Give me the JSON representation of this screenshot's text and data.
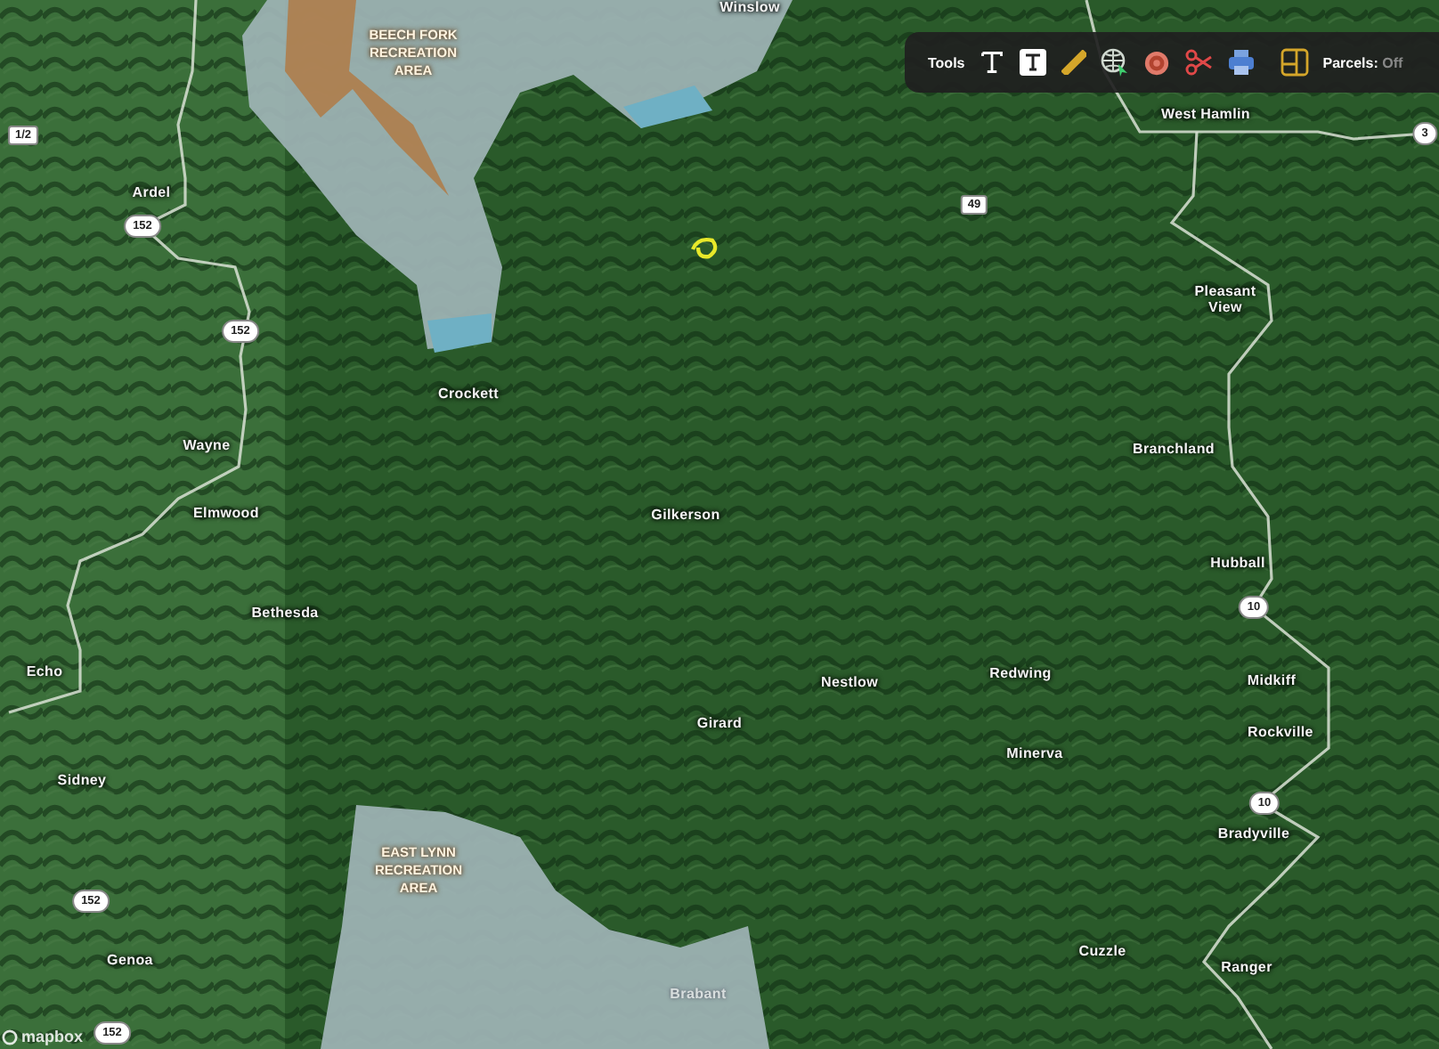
{
  "toolbar": {
    "label": "Tools",
    "parcels": {
      "label": "Parcels:",
      "value": "Off"
    }
  },
  "map": {
    "areas": [
      {
        "name": "BEECH FORK RECREATION AREA"
      },
      {
        "name": "EAST LYNN RECREATION AREA"
      }
    ],
    "places": [
      {
        "name": "Winslow"
      },
      {
        "name": "West Hamlin"
      },
      {
        "name": "Ardel"
      },
      {
        "name": "Crockett"
      },
      {
        "name": "Wayne"
      },
      {
        "name": "Elmwood"
      },
      {
        "name": "Gilkerson"
      },
      {
        "name": "Pleasant View"
      },
      {
        "name": "Branchland"
      },
      {
        "name": "Hubball"
      },
      {
        "name": "Bethesda"
      },
      {
        "name": "Echo"
      },
      {
        "name": "Nestlow"
      },
      {
        "name": "Redwing"
      },
      {
        "name": "Midkiff"
      },
      {
        "name": "Girard"
      },
      {
        "name": "Rockville"
      },
      {
        "name": "Minerva"
      },
      {
        "name": "Sidney"
      },
      {
        "name": "Bradyville"
      },
      {
        "name": "Genoa"
      },
      {
        "name": "Cuzzle"
      },
      {
        "name": "Ranger"
      },
      {
        "name": "Brabant",
        "kind": "faded"
      }
    ],
    "shields": [
      {
        "number": "1/2"
      },
      {
        "number": "152"
      },
      {
        "number": "152"
      },
      {
        "number": "49"
      },
      {
        "number": "3"
      },
      {
        "number": "10"
      },
      {
        "number": "10"
      },
      {
        "number": "152"
      },
      {
        "number": "152"
      }
    ],
    "attribution": "mapbox"
  }
}
